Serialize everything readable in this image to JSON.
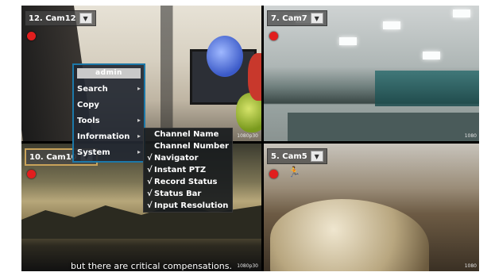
{
  "cameras": {
    "cam12": {
      "title": "12. Cam12",
      "resolution": "1080p30"
    },
    "cam7": {
      "title": "7. Cam7",
      "resolution": "1080"
    },
    "cam10": {
      "title": "10. Cam10",
      "resolution": "1080p30"
    },
    "cam5": {
      "title": "5. Cam5",
      "resolution": "1080"
    }
  },
  "context_menu": {
    "header": "admin",
    "items": [
      {
        "label": "Search",
        "has_submenu": true
      },
      {
        "label": "Copy",
        "has_submenu": false
      },
      {
        "label": "Tools",
        "has_submenu": true
      },
      {
        "label": "Information",
        "has_submenu": true
      },
      {
        "label": "System",
        "has_submenu": true
      }
    ]
  },
  "display_submenu": {
    "items": [
      {
        "label": "Channel Name",
        "checked": false
      },
      {
        "label": "Channel Number",
        "checked": false
      },
      {
        "label": "Navigator",
        "checked": true
      },
      {
        "label": "Instant PTZ",
        "checked": true
      },
      {
        "label": "Record Status",
        "checked": true
      },
      {
        "label": "Status Bar",
        "checked": true
      },
      {
        "label": "Input Resolution",
        "checked": true
      }
    ]
  },
  "caption": "but there are critical compensations.",
  "icons": {
    "dropdown": "chevron-down-icon",
    "record": "record-dot-icon",
    "motion": "running-person-icon",
    "submenu_arrow": "chevron-right-icon"
  },
  "colors": {
    "record_red": "#e11e1e",
    "menu_border": "#1c78a8",
    "motion_blue": "#24a6ff"
  }
}
